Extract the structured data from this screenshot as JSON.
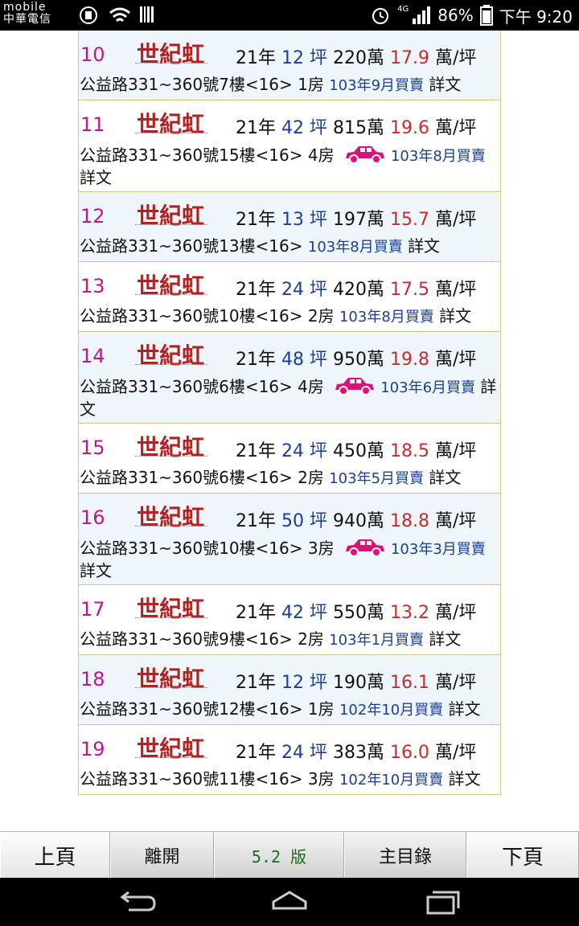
{
  "status_bar": {
    "carrier_line1": "mobile",
    "carrier_line2": "中華電信",
    "battery": "86%",
    "time": "下午 9:20",
    "network": "4G"
  },
  "logo_text": "世紀虹",
  "listings": [
    {
      "idx": "10",
      "age": "21年",
      "size": "12",
      "price": "220萬",
      "unit": "17.9",
      "addr": "公益路331~360號7樓<16> 1房",
      "car": false,
      "date": "103年9月買賣",
      "more": "詳文"
    },
    {
      "idx": "11",
      "age": "21年",
      "size": "42",
      "price": "815萬",
      "unit": "19.6",
      "addr": "公益路331~360號15樓<16> 4房",
      "car": true,
      "date": "103年8月買賣",
      "more": "詳文"
    },
    {
      "idx": "12",
      "age": "21年",
      "size": "13",
      "price": "197萬",
      "unit": "15.7",
      "addr": "公益路331~360號13樓<16>",
      "car": false,
      "date": "103年8月買賣",
      "more": "詳文"
    },
    {
      "idx": "13",
      "age": "21年",
      "size": "24",
      "price": "420萬",
      "unit": "17.5",
      "addr": "公益路331~360號10樓<16> 2房",
      "car": false,
      "date": "103年8月買賣",
      "more": "詳文"
    },
    {
      "idx": "14",
      "age": "21年",
      "size": "48",
      "price": "950萬",
      "unit": "19.8",
      "addr": "公益路331~360號6樓<16> 4房",
      "car": true,
      "date": "103年6月買賣",
      "more": "詳文"
    },
    {
      "idx": "15",
      "age": "21年",
      "size": "24",
      "price": "450萬",
      "unit": "18.5",
      "addr": "公益路331~360號6樓<16> 2房",
      "car": false,
      "date": "103年5月買賣",
      "more": "詳文"
    },
    {
      "idx": "16",
      "age": "21年",
      "size": "50",
      "price": "940萬",
      "unit": "18.8",
      "addr": "公益路331~360號10樓<16> 3房",
      "car": true,
      "date": "103年3月買賣",
      "more": "詳文"
    },
    {
      "idx": "17",
      "age": "21年",
      "size": "42",
      "price": "550萬",
      "unit": "13.2",
      "addr": "公益路331~360號9樓<16> 2房",
      "car": false,
      "date": "103年1月買賣",
      "more": "詳文"
    },
    {
      "idx": "18",
      "age": "21年",
      "size": "12",
      "price": "190萬",
      "unit": "16.1",
      "addr": "公益路331~360號12樓<16> 1房",
      "car": false,
      "date": "102年10月買賣",
      "more": "詳文"
    },
    {
      "idx": "19",
      "age": "21年",
      "size": "24",
      "price": "383萬",
      "unit": "16.0",
      "addr": "公益路331~360號11樓<16> 3房",
      "car": false,
      "date": "102年10月買賣",
      "more": "詳文"
    }
  ],
  "labels": {
    "ping": "坪",
    "per_ping": "萬/坪"
  },
  "nav": {
    "prev": "上頁",
    "exit": "離開",
    "version": "5.2 版",
    "menu": "主目錄",
    "next": "下頁"
  },
  "colors": {
    "index": "#c0168c",
    "size": "#1a3e9c",
    "unit_price": "#cc2a2a",
    "car_icon": "#e0107a"
  }
}
